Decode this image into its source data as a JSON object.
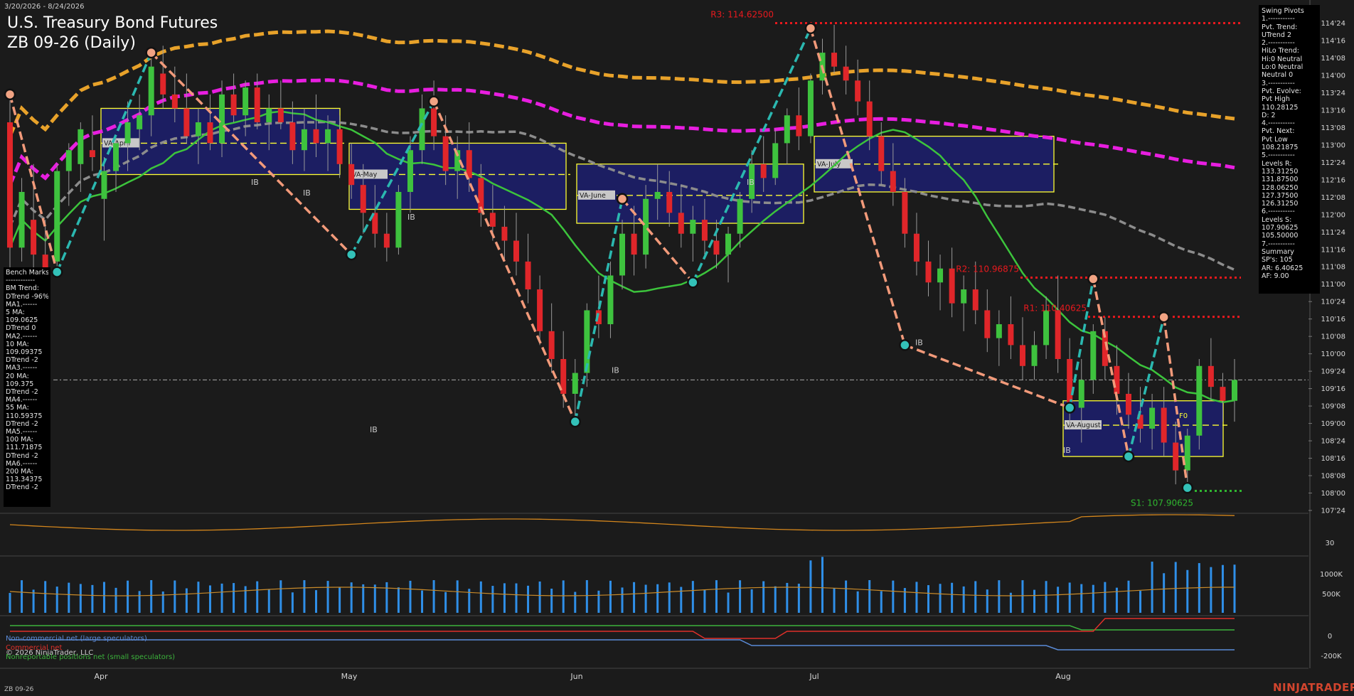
{
  "header": {
    "date_range": "3/20/2026 - 8/24/2026",
    "title": "U.S. Treasury Bond Futures",
    "subtitle": "ZB 09-26 (Daily)"
  },
  "footer": {
    "instrument": "ZB 09-26",
    "brand": "NINJATRADER"
  },
  "colors": {
    "bull": "#3ec23e",
    "bear": "#e0262a",
    "ma_green": "#3cc43c",
    "ma_gray": "#8c8c8c",
    "ma_magenta": "#e81ee0",
    "ma_orange": "#e8a22a",
    "swing_up": "#2bb8b0",
    "swing_down": "#f29a7a",
    "box_fill": "#1c1f6e",
    "box_edge": "#ffff33",
    "resistance": "#e8191e",
    "support": "#2fb52f"
  },
  "chart_data": [
    {
      "type": "candlestick",
      "title": "ZB 09-26 (Daily)",
      "price_unit": "points and 32nds",
      "y_ticks": [
        "114'24",
        "114'16",
        "114'08",
        "114'00",
        "113'24",
        "113'16",
        "113'08",
        "113'00",
        "112'24",
        "112'16",
        "112'08",
        "112'00",
        "111'24",
        "111'16",
        "111'08",
        "111'00",
        "110'24",
        "110'16",
        "110'08",
        "110'00",
        "109'24",
        "109'16",
        "109'08",
        "109'00",
        "108'24",
        "108'16",
        "108'08",
        "108'00",
        "107'24"
      ],
      "ylim": [
        107.625,
        114.875
      ],
      "x_labels": [
        "Apr",
        "May",
        "Jun",
        "Jul",
        "Aug"
      ],
      "current_price": 109.5,
      "ohlc_approx": [
        [
          113.2,
          113.6,
          110.9,
          111.4
        ],
        [
          111.4,
          112.4,
          111.2,
          112.2
        ],
        [
          111.8,
          112.6,
          111.0,
          111.3
        ],
        [
          111.3,
          111.8,
          110.9,
          111.1
        ],
        [
          111.2,
          112.6,
          111.1,
          112.5
        ],
        [
          112.5,
          112.9,
          112.0,
          112.8
        ],
        [
          112.6,
          113.2,
          112.2,
          113.1
        ],
        [
          112.8,
          113.3,
          112.5,
          112.7
        ],
        [
          112.1,
          112.7,
          111.5,
          112.5
        ],
        [
          112.5,
          113.0,
          112.2,
          112.9
        ],
        [
          112.9,
          113.5,
          112.5,
          113.2
        ],
        [
          113.1,
          113.6,
          112.8,
          113.3
        ],
        [
          113.3,
          114.2,
          113.0,
          114.0
        ],
        [
          113.9,
          114.3,
          113.4,
          113.6
        ],
        [
          113.6,
          114.0,
          113.2,
          113.4
        ],
        [
          113.4,
          113.9,
          112.9,
          113.0
        ],
        [
          113.0,
          113.4,
          112.6,
          113.2
        ],
        [
          113.2,
          113.6,
          112.8,
          112.9
        ],
        [
          112.9,
          113.8,
          112.7,
          113.6
        ],
        [
          113.6,
          113.9,
          113.2,
          113.3
        ],
        [
          113.3,
          113.8,
          113.0,
          113.7
        ],
        [
          113.7,
          113.9,
          113.1,
          113.2
        ],
        [
          113.2,
          113.6,
          112.8,
          113.4
        ],
        [
          113.4,
          113.8,
          113.1,
          113.2
        ],
        [
          113.2,
          113.5,
          112.6,
          112.8
        ],
        [
          112.8,
          113.4,
          112.5,
          113.1
        ],
        [
          113.1,
          113.6,
          112.7,
          112.9
        ],
        [
          112.9,
          113.3,
          112.5,
          113.1
        ],
        [
          113.1,
          113.3,
          112.4,
          112.6
        ],
        [
          112.6,
          112.9,
          112.1,
          112.3
        ],
        [
          112.3,
          112.6,
          111.6,
          111.9
        ],
        [
          111.9,
          112.3,
          111.4,
          111.6
        ],
        [
          111.6,
          111.9,
          111.2,
          111.4
        ],
        [
          111.4,
          112.3,
          111.3,
          112.2
        ],
        [
          112.2,
          113.0,
          111.9,
          112.8
        ],
        [
          112.8,
          113.6,
          112.6,
          113.4
        ],
        [
          113.4,
          113.8,
          112.8,
          113.0
        ],
        [
          113.0,
          113.3,
          112.3,
          112.5
        ],
        [
          112.5,
          113.0,
          112.1,
          112.8
        ],
        [
          112.8,
          113.2,
          112.2,
          112.4
        ],
        [
          112.4,
          112.6,
          111.7,
          111.9
        ],
        [
          111.9,
          112.3,
          111.5,
          111.7
        ],
        [
          111.7,
          112.0,
          111.2,
          111.5
        ],
        [
          111.5,
          111.9,
          111.0,
          111.2
        ],
        [
          111.2,
          111.6,
          110.6,
          110.8
        ],
        [
          110.8,
          111.0,
          110.0,
          110.2
        ],
        [
          110.2,
          110.6,
          109.6,
          109.8
        ],
        [
          109.8,
          110.2,
          109.1,
          109.3
        ],
        [
          109.3,
          109.8,
          108.9,
          109.6
        ],
        [
          109.6,
          110.6,
          109.4,
          110.5
        ],
        [
          110.5,
          111.0,
          110.1,
          110.3
        ],
        [
          110.3,
          111.2,
          110.1,
          111.0
        ],
        [
          111.0,
          111.8,
          110.8,
          111.6
        ],
        [
          111.6,
          112.0,
          111.0,
          111.3
        ],
        [
          111.3,
          112.3,
          111.1,
          112.1
        ],
        [
          112.1,
          112.6,
          111.8,
          112.2
        ],
        [
          112.2,
          112.5,
          111.7,
          111.9
        ],
        [
          111.9,
          112.3,
          111.4,
          111.6
        ],
        [
          111.6,
          112.0,
          111.2,
          111.8
        ],
        [
          111.8,
          112.1,
          111.3,
          111.5
        ],
        [
          111.5,
          111.8,
          111.1,
          111.3
        ],
        [
          111.3,
          111.7,
          110.9,
          111.6
        ],
        [
          111.6,
          112.2,
          111.4,
          112.1
        ],
        [
          112.1,
          112.8,
          111.9,
          112.6
        ],
        [
          112.6,
          113.0,
          112.2,
          112.4
        ],
        [
          112.4,
          113.1,
          112.3,
          112.9
        ],
        [
          112.9,
          113.4,
          112.6,
          113.3
        ],
        [
          113.3,
          113.7,
          112.8,
          113.0
        ],
        [
          113.0,
          113.9,
          112.9,
          113.8
        ],
        [
          113.8,
          114.4,
          113.6,
          114.2
        ],
        [
          114.2,
          114.6,
          113.9,
          114.0
        ],
        [
          114.0,
          114.3,
          113.6,
          113.8
        ],
        [
          113.8,
          114.1,
          113.3,
          113.5
        ],
        [
          113.5,
          113.8,
          112.8,
          113.0
        ],
        [
          113.0,
          113.2,
          112.3,
          112.5
        ],
        [
          112.5,
          112.9,
          112.0,
          112.2
        ],
        [
          112.2,
          112.4,
          111.4,
          111.6
        ],
        [
          111.6,
          111.9,
          111.0,
          111.2
        ],
        [
          111.2,
          111.5,
          110.7,
          110.9
        ],
        [
          110.9,
          111.3,
          110.5,
          111.1
        ],
        [
          111.1,
          111.4,
          110.4,
          110.6
        ],
        [
          110.6,
          111.0,
          110.2,
          110.8
        ],
        [
          110.8,
          111.2,
          110.3,
          110.5
        ],
        [
          110.5,
          110.8,
          109.9,
          110.1
        ],
        [
          110.1,
          110.5,
          109.7,
          110.3
        ],
        [
          110.3,
          110.7,
          109.8,
          110.0
        ],
        [
          110.0,
          110.4,
          109.5,
          109.7
        ],
        [
          109.7,
          110.2,
          109.5,
          110.0
        ],
        [
          110.0,
          110.7,
          109.8,
          110.5
        ],
        [
          110.5,
          111.0,
          109.6,
          109.8
        ],
        [
          109.8,
          110.1,
          108.8,
          109.1
        ],
        [
          109.1,
          109.8,
          108.6,
          109.5
        ],
        [
          109.5,
          110.3,
          109.3,
          110.2
        ],
        [
          110.2,
          110.4,
          109.5,
          109.7
        ],
        [
          109.7,
          110.0,
          109.0,
          109.3
        ],
        [
          109.3,
          109.6,
          108.8,
          109.0
        ],
        [
          109.0,
          109.4,
          108.6,
          108.8
        ],
        [
          108.8,
          109.3,
          108.5,
          109.1
        ],
        [
          109.1,
          109.4,
          108.4,
          108.6
        ],
        [
          108.6,
          108.9,
          108.0,
          108.2
        ],
        [
          108.2,
          108.8,
          107.9,
          108.7
        ],
        [
          108.7,
          109.8,
          108.5,
          109.7
        ],
        [
          109.7,
          110.1,
          109.2,
          109.4
        ],
        [
          109.4,
          109.6,
          108.9,
          109.2
        ],
        [
          109.2,
          109.8,
          108.9,
          109.5
        ]
      ],
      "levels": [
        {
          "label": "R3: 114.62500",
          "value": 114.625
        },
        {
          "label": "R2: 110.96875",
          "value": 110.96875
        },
        {
          "label": "R1: 110.40625",
          "value": 110.40625
        },
        {
          "label": "S1: 107.90625",
          "value": 107.90625
        }
      ],
      "value_area_boxes": [
        {
          "label": "VA-April",
          "high": 113.4,
          "low": 112.45,
          "mid": 112.9
        },
        {
          "label": "VA-May",
          "high": 112.9,
          "low": 111.95,
          "mid": 112.45
        },
        {
          "label": "VA-June",
          "high": 112.6,
          "low": 111.75,
          "mid": 112.15
        },
        {
          "label": "VA-July",
          "high": 113.0,
          "low": 112.2,
          "mid": 112.6
        },
        {
          "label": "VA-August",
          "high": 109.2,
          "low": 108.4,
          "mid": 108.85
        }
      ],
      "ib_labels": [
        "IB",
        "IB",
        "IB",
        "IB",
        "IB",
        "IB",
        "IB",
        "IB",
        "IB"
      ],
      "misc_labels": [
        "F0"
      ]
    },
    {
      "type": "line",
      "name": "oscillator",
      "y_ticks": [
        "30"
      ]
    },
    {
      "type": "bar",
      "name": "volume",
      "y_ticks": [
        "1000K",
        "500K"
      ]
    },
    {
      "type": "line",
      "name": "COT",
      "y_ticks": [
        "0",
        "-200K"
      ],
      "series": [
        {
          "name": "Non-commercial net (large speculators)"
        },
        {
          "name": "Commercial net"
        },
        {
          "name": "Nonreportable positions net (small speculators)"
        }
      ]
    }
  ],
  "bench_marks": [
    "Bench Marks",
    "------------",
    "BM Trend:",
    "DTrend -96%",
    "MA1.------",
    "5 MA:",
    "109.0625",
    "DTrend 0",
    "MA2.------",
    "10 MA:",
    "109.09375",
    "DTrend -2",
    "MA3.------",
    "20 MA:",
    "109.375",
    "DTrend -2",
    "MA4.------",
    "55 MA:",
    "110.59375",
    "DTrend -2",
    "MA5.------",
    "100 MA:",
    "111.71875",
    "DTrend -2",
    "MA6.------",
    "200 MA:",
    "113.34375",
    "DTrend -2"
  ],
  "swing_pivots": [
    "Swing Pivots",
    "1.-----------",
    "Pvt. Trend:",
    "UTrend 2",
    "2.-----------",
    "HiLo Trend:",
    "Hi:0 Neutral",
    "Lo:0 Neutral",
    "Neutral 0",
    "3.-----------",
    "Pvt. Evolve:",
    "Pvt High",
    "110.28125",
    "D: 2",
    "4.-----------",
    "Pvt. Next:",
    "Pvt Low",
    "108.21875",
    "5.-----------",
    "Levels R:",
    "133.31250",
    "131.87500",
    "128.06250",
    "127.37500",
    "126.31250",
    "6.-----------",
    "Levels S:",
    "107.90625",
    "105.50000",
    "7.-----------",
    "Summary",
    "SP's: 105",
    "AR: 6.40625",
    "AF: 9.00"
  ],
  "legend": {
    "large": "Non-commercial net (large speculators)",
    "commercial": "Commercial net",
    "copyright": "© 2026 NinjaTrader, LLC",
    "small": "Nonreportable positions net (small speculators)"
  }
}
